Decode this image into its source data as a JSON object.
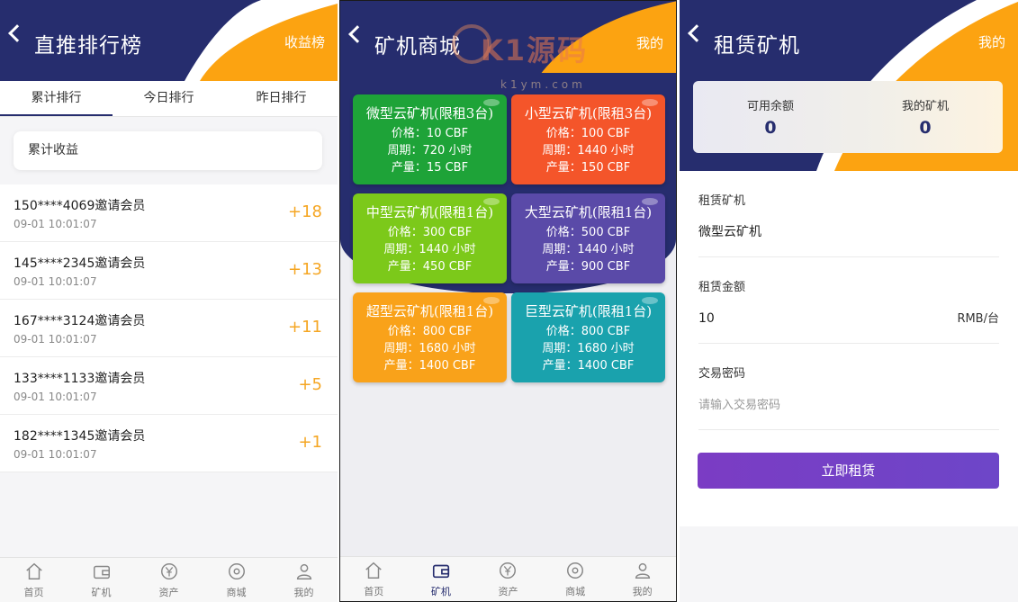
{
  "ranking": {
    "title": "直推排行榜",
    "right_link": "收益榜",
    "tabs": [
      "累计排行",
      "今日排行",
      "昨日排行"
    ],
    "summary_label": "累计收益",
    "rows": [
      {
        "who": "150****4069邀请会员",
        "time": "09-01 10:01:07",
        "amount": "+18"
      },
      {
        "who": "145****2345邀请会员",
        "time": "09-01 10:01:07",
        "amount": "+13"
      },
      {
        "who": "167****3124邀请会员",
        "time": "09-01 10:01:07",
        "amount": "+11"
      },
      {
        "who": "133****1133邀请会员",
        "time": "09-01 10:01:07",
        "amount": "+5"
      },
      {
        "who": "182****1345邀请会员",
        "time": "09-01 10:01:07",
        "amount": "+1"
      }
    ]
  },
  "shop": {
    "title": "矿机商城",
    "right_link": "我的",
    "watermark": {
      "brand": "K1源码",
      "url": "k1ym.com"
    },
    "machines": [
      {
        "name": "微型云矿机(限租3台)",
        "price": "价格：10 CBF",
        "period": "周期：720 小时",
        "output": "产量：15 CBF",
        "color": "#1ea338"
      },
      {
        "name": "小型云矿机(限租3台)",
        "price": "价格：100 CBF",
        "period": "周期：1440 小时",
        "output": "产量：150 CBF",
        "color": "#f4552a"
      },
      {
        "name": "中型云矿机(限租1台)",
        "price": "价格：300 CBF",
        "period": "周期：1440 小时",
        "output": "产量：450 CBF",
        "color": "#7cc91a"
      },
      {
        "name": "大型云矿机(限租1台)",
        "price": "价格：500 CBF",
        "period": "周期：1440 小时",
        "output": "产量：900 CBF",
        "color": "#5a4aa8"
      },
      {
        "name": "超型云矿机(限租1台)",
        "price": "价格：800 CBF",
        "period": "周期：1680 小时",
        "output": "产量：1400 CBF",
        "color": "#f9a21a"
      },
      {
        "name": "巨型云矿机(限租1台)",
        "price": "价格：800 CBF",
        "period": "周期：1680 小时",
        "output": "产量：1400 CBF",
        "color": "#1aa2ad"
      }
    ]
  },
  "rent": {
    "title": "租赁矿机",
    "right_link": "我的",
    "balance_label": "可用余额",
    "balance_value": "0",
    "my_machines_label": "我的矿机",
    "my_machines_value": "0",
    "machine_label": "租赁矿机",
    "machine_value": "微型云矿机",
    "amount_label": "租赁金额",
    "amount_value": "10",
    "amount_unit": "RMB/台",
    "password_label": "交易密码",
    "password_placeholder": "请输入交易密码",
    "submit_label": "立即租赁"
  },
  "tabbar": [
    "首页",
    "矿机",
    "资产",
    "商城",
    "我的"
  ],
  "colors": {
    "navy": "#262d6e",
    "orange": "#fca311",
    "accent_amount": "#f5a623",
    "button": "#7b3cc4"
  }
}
